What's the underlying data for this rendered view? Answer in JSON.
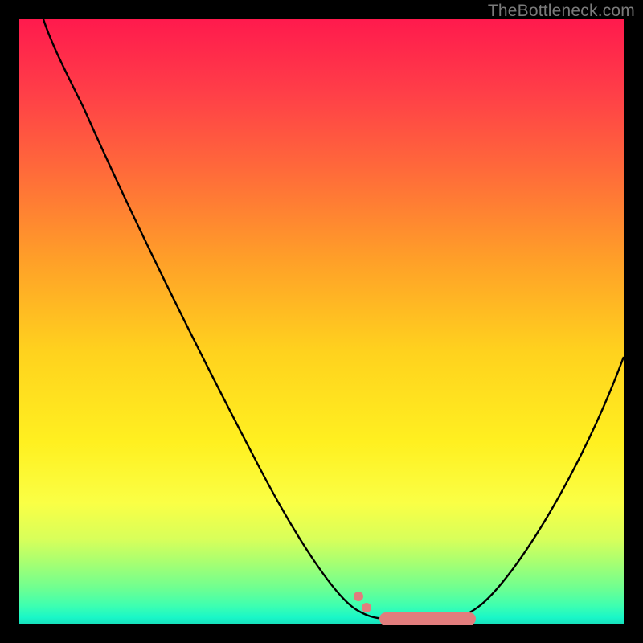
{
  "watermark": "TheBottleneck.com",
  "colors": {
    "frame": "#000000",
    "curve_stroke": "#000000",
    "marker_fill": "#e27d7d",
    "marker_stroke": "#d86b6b"
  },
  "chart_data": {
    "type": "line",
    "title": "",
    "xlabel": "",
    "ylabel": "",
    "xlim": [
      0,
      100
    ],
    "ylim": [
      0,
      100
    ],
    "grid": false,
    "legend": false,
    "series": [
      {
        "name": "bottleneck-curve",
        "x": [
          4,
          8,
          12,
          16,
          20,
          24,
          28,
          32,
          36,
          40,
          44,
          48,
          52,
          54,
          56,
          58,
          60,
          62,
          64,
          66,
          68,
          70,
          72,
          74,
          78,
          82,
          86,
          90,
          94,
          98,
          100
        ],
        "y": [
          100,
          94,
          88,
          82,
          76,
          70,
          64,
          57,
          50,
          44,
          37,
          30,
          22,
          18,
          13,
          8,
          4,
          2,
          1,
          0.6,
          0.6,
          0.6,
          1,
          2,
          6,
          12,
          20,
          28,
          37,
          46,
          50
        ]
      }
    ],
    "markers": [
      {
        "name": "flat-span",
        "shape": "rounded-bar",
        "x_start": 62,
        "x_end": 76,
        "y": 0.6
      },
      {
        "name": "left-dot",
        "shape": "dot",
        "x": 56,
        "y": 10
      },
      {
        "name": "left-dot-2",
        "shape": "dot",
        "x": 58,
        "y": 6
      }
    ],
    "background_gradient": {
      "top_color": "#ff1a4d",
      "mid_color": "#ffe020",
      "bottom_color": "#19f7c8",
      "meaning": "red=high-bottleneck, green=low-bottleneck"
    }
  }
}
